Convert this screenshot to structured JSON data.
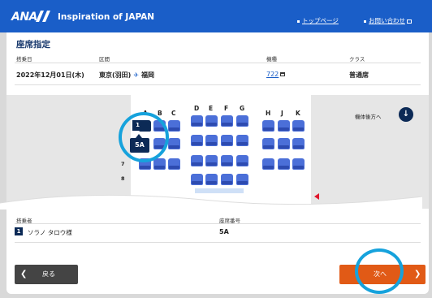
{
  "header": {
    "logo": "ANA",
    "tagline": "Inspiration of JAPAN",
    "links": [
      "トップページ",
      "お問い合わせ"
    ],
    "color": "#1a5ec8"
  },
  "page": {
    "title": "座席指定"
  },
  "flight": {
    "headers": [
      "搭乗日",
      "区間",
      "機種",
      "クラス"
    ],
    "date": "2022年12月01日(木)",
    "origin": "東京(羽田)",
    "destination": "福岡",
    "aircraft": "722",
    "class": "普通席"
  },
  "seatmap": {
    "columns": [
      "A",
      "B",
      "C",
      "D",
      "E",
      "F",
      "G",
      "H",
      "J",
      "K"
    ],
    "rows": [
      "7",
      "8"
    ],
    "selected_badge": "1",
    "selected_seat": "5A",
    "rear_label": "機体後方へ",
    "seat_color": "#4b6fd8",
    "selected_color": "#0c2a56",
    "highlight_color": "#16a2dc"
  },
  "passengers": {
    "headers": [
      "搭乗者",
      "座席番号"
    ],
    "list": [
      {
        "num": "1",
        "name": "ソラノ タロウ様",
        "seat": "5A"
      }
    ]
  },
  "buttons": {
    "back": "戻る",
    "next": "次へ",
    "next_color": "#e15a16"
  }
}
